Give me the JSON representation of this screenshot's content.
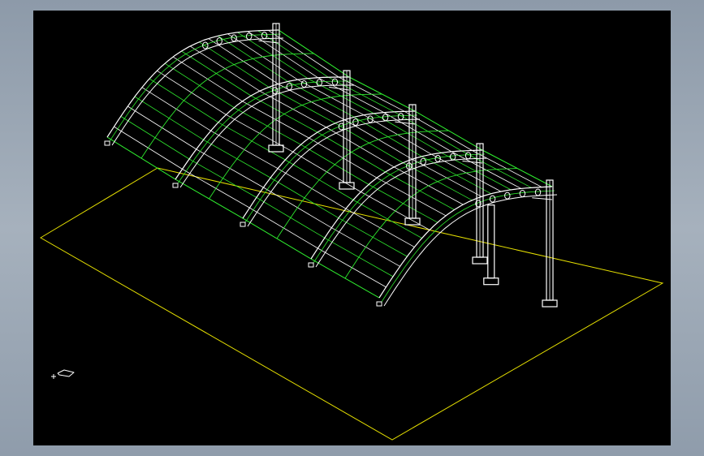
{
  "viewport": {
    "background": "#000000",
    "ground_color": "#e6e000",
    "structure_color": "#ffffff",
    "membrane_color": "#2ee82e"
  },
  "drawing": {
    "subject": "canopy-frame-3d",
    "arch_count": 5,
    "column_count": 5,
    "ucs_icon": "ucs-icon"
  }
}
